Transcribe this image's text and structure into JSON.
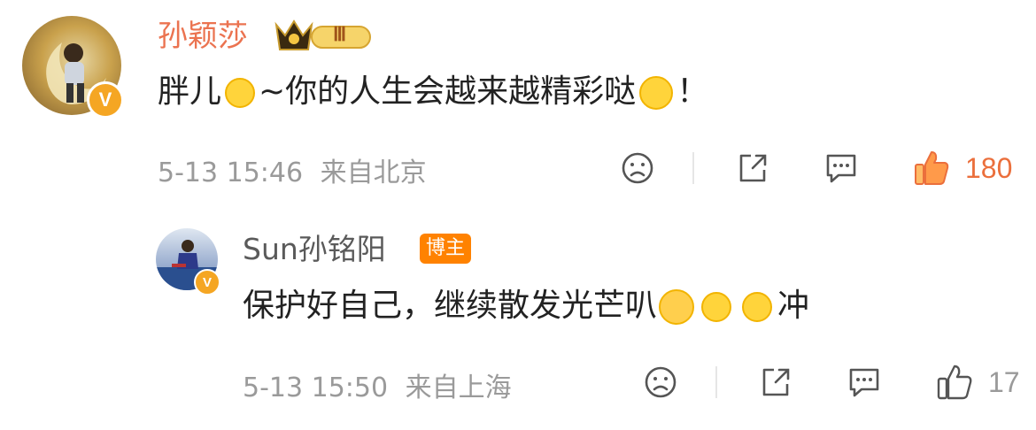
{
  "comment": {
    "author": "孙颖莎",
    "vip_badge_text": "Ⅲ",
    "text_before": "胖儿",
    "text_middle": "~你的人生会越来越精彩哒",
    "text_end": "！",
    "timestamp": "5-13 15:46",
    "location": "来自北京",
    "like_count": "180",
    "colors": {
      "name": "#eb7350",
      "like_active": "#eb6f3c"
    }
  },
  "reply": {
    "author": "Sun孙铭阳",
    "tag": "博主",
    "text_main": "保护好自己，继续散发光芒叭",
    "text_end": "冲",
    "timestamp": "5-13 15:50",
    "location": "来自上海",
    "like_count": "17",
    "colors": {
      "tag_bg": "#ff8200"
    }
  },
  "icons": {
    "verified": "verified-v-badge",
    "dislike": "sad-face-icon",
    "share": "share-icon",
    "comment": "comment-icon",
    "like": "thumbs-up-icon"
  }
}
